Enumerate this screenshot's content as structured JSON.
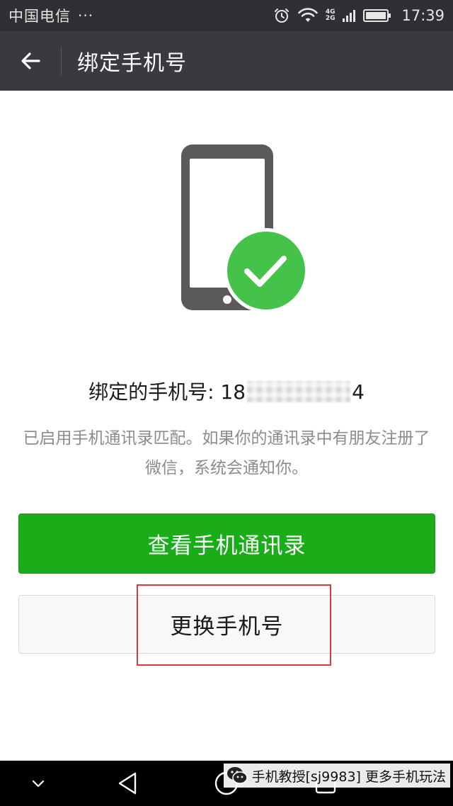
{
  "status_bar": {
    "carrier": "中国电信",
    "more": "···",
    "net_4g": "4G",
    "net_2g": "2G",
    "time": "17:39",
    "icons": [
      "alarm-icon",
      "wifi-icon",
      "signal-icon",
      "battery-icon"
    ]
  },
  "app_bar": {
    "back_icon": "arrow-left-icon",
    "title": "绑定手机号"
  },
  "illustration": {
    "icons": [
      "phone-icon",
      "check-circle-icon"
    ],
    "phone_color": "#5a5a5a",
    "check_color": "#44c24a"
  },
  "bound": {
    "label": "绑定的手机号: ",
    "prefix": "18",
    "suffix": "4"
  },
  "notice": "已启用手机通讯录匹配。如果你的通讯录中有朋友注册了微信，系统会通知你。",
  "buttons": {
    "view_contacts": "查看手机通讯录",
    "change_phone": "更换手机号"
  },
  "colors": {
    "primary": "#1aad19",
    "app_bar": "#393a3f",
    "status_bar": "#2f3033",
    "highlight": "#d93a3a"
  },
  "nav_bar": {
    "icons": [
      "chevron-down-icon",
      "nav-back-icon",
      "nav-home-icon",
      "nav-recents-icon"
    ]
  },
  "watermark": {
    "icon": "wechat-icon",
    "text": "手机教授[sj9983] 更多手机玩法"
  }
}
